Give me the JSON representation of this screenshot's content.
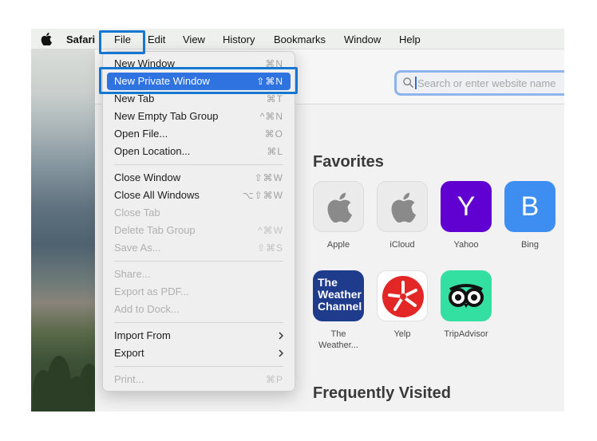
{
  "menubar": {
    "apple_icon": "apple-icon",
    "app_name": "Safari",
    "items": [
      "File",
      "Edit",
      "View",
      "History",
      "Bookmarks",
      "Window",
      "Help"
    ]
  },
  "address_bar": {
    "placeholder": "Search or enter website name",
    "icon": "magnifier-icon"
  },
  "file_menu": {
    "new_window": {
      "label": "New Window",
      "shortcut": "⌘N"
    },
    "new_private_window": {
      "label": "New Private Window",
      "shortcut": "⇧⌘N"
    },
    "new_tab": {
      "label": "New Tab",
      "shortcut": "⌘T"
    },
    "new_empty_tab_group": {
      "label": "New Empty Tab Group",
      "shortcut": "^⌘N"
    },
    "open_file": {
      "label": "Open File...",
      "shortcut": "⌘O"
    },
    "open_location": {
      "label": "Open Location...",
      "shortcut": "⌘L"
    },
    "close_window": {
      "label": "Close Window",
      "shortcut": "⇧⌘W"
    },
    "close_all_windows": {
      "label": "Close All Windows",
      "shortcut": "⌥⇧⌘W"
    },
    "close_tab": {
      "label": "Close Tab",
      "shortcut": ""
    },
    "delete_tab_group": {
      "label": "Delete Tab Group",
      "shortcut": "^⌘W"
    },
    "save_as": {
      "label": "Save As...",
      "shortcut": "⇧⌘S"
    },
    "share": {
      "label": "Share...",
      "shortcut": ""
    },
    "export_as_pdf": {
      "label": "Export as PDF...",
      "shortcut": ""
    },
    "add_to_dock": {
      "label": "Add to Dock...",
      "shortcut": ""
    },
    "import_from": {
      "label": "Import From",
      "shortcut": ""
    },
    "export": {
      "label": "Export",
      "shortcut": ""
    },
    "print": {
      "label": "Print...",
      "shortcut": "⌘P"
    }
  },
  "favorites": {
    "title": "Favorites",
    "items": [
      {
        "label": "Apple",
        "icon": "apple-icon"
      },
      {
        "label": "iCloud",
        "icon": "apple-icon"
      },
      {
        "label": "Yahoo",
        "icon_text": "Y"
      },
      {
        "label": "Bing",
        "icon_text": "B"
      },
      {
        "label": "The Weather...",
        "label_line1": "The",
        "label_line2": "Weather...",
        "icon_text": "The Weather Channel",
        "icon_lines": [
          "The",
          "Weather",
          "Channel"
        ]
      },
      {
        "label": "Yelp",
        "icon": "yelp-burst-icon"
      },
      {
        "label": "TripAdvisor",
        "icon": "owl-icon"
      }
    ]
  },
  "frequently_visited": {
    "title": "Frequently Visited"
  },
  "colors": {
    "highlight_outline": "#1677d2",
    "menu_selection": "#2f73e0",
    "yahoo": "#6001d2",
    "bing": "#3d8ef0",
    "weather_channel": "#1f3b8c",
    "yelp": "#e32727",
    "tripadvisor": "#34e0a1"
  }
}
